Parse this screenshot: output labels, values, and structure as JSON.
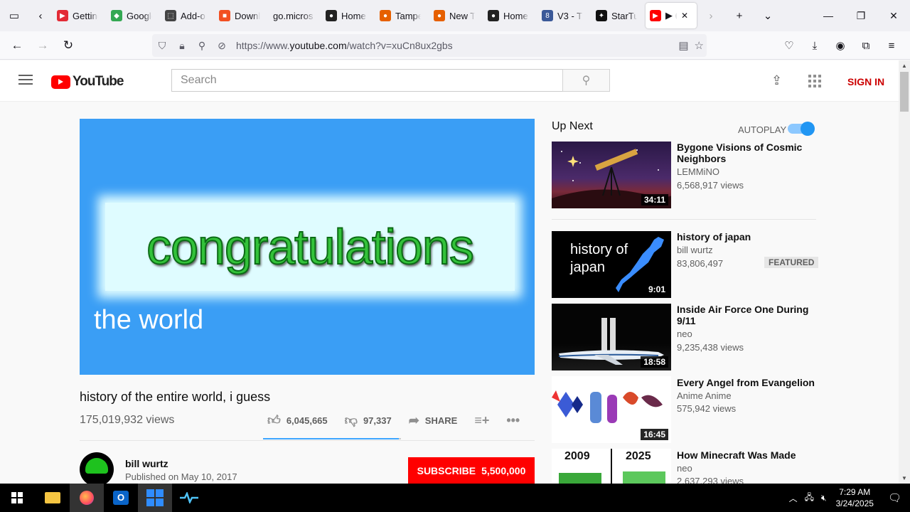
{
  "browser": {
    "tabs": [
      {
        "title": "Getting",
        "color": "#e32b36",
        "glyph": "▶"
      },
      {
        "title": "Google",
        "color": "#34a853",
        "glyph": "◆"
      },
      {
        "title": "Add-o",
        "color": "#444",
        "glyph": "⬚"
      },
      {
        "title": "Downl",
        "color": "#f25022",
        "glyph": "■"
      },
      {
        "title": "go.micros",
        "color": "",
        "glyph": ""
      },
      {
        "title": "Home",
        "color": "#222",
        "glyph": "●"
      },
      {
        "title": "Tampe",
        "color": "#e66000",
        "glyph": "●"
      },
      {
        "title": "New T",
        "color": "#e66000",
        "glyph": "●"
      },
      {
        "title": "Home",
        "color": "#222",
        "glyph": "●"
      },
      {
        "title": "V3 - T",
        "color": "#3b5998",
        "glyph": "8"
      },
      {
        "title": "StarTu",
        "color": "#111",
        "glyph": "✦"
      },
      {
        "title": "▶ (",
        "color": "#ff0000",
        "glyph": "▶"
      }
    ],
    "url_prefix": "https://www.",
    "url_domain": "youtube.com",
    "url_path": "/watch?v=xuCn8ux2gbs"
  },
  "youtube": {
    "logo_text": "YouTube",
    "search_placeholder": "Search",
    "sign_in": "SIGN IN"
  },
  "video": {
    "banner_text": "congratulations",
    "sub_text": "the world",
    "title": "history of the entire world, i guess",
    "views": "175,019,932 views",
    "likes": "6,045,665",
    "like_ratio": 0.984,
    "dislikes": "97,337",
    "share": "SHARE",
    "channel": "bill wurtz",
    "published": "Published on May 10, 2017",
    "subscribe": "SUBSCRIBE",
    "subscribers": "5,500,000"
  },
  "sidebar": {
    "up_next": "Up Next",
    "autoplay": "AUTOPLAY",
    "autoplay_on": true,
    "items": [
      {
        "title": "Bygone Visions of Cosmic Neighbors",
        "channel": "LEMMiNO",
        "views": "6,568,917 views",
        "duration": "34:11"
      },
      {
        "title": "history of japan",
        "channel": "bill wurtz",
        "views": "83,806,497",
        "duration": "9:01",
        "badge": "FEATURED",
        "thumb_text": "history of japan"
      },
      {
        "title": "Inside Air Force One During 9/11",
        "channel": "neo",
        "views": "9,235,438 views",
        "duration": "18:58"
      },
      {
        "title": "Every Angel from Evangelion",
        "channel": "Anime Anime",
        "views": "575,942 views",
        "duration": "16:45"
      },
      {
        "title": "How Minecraft Was Made",
        "channel": "neo",
        "views": "2,637,293 views",
        "thumb_left": "2009",
        "thumb_right": "2025"
      }
    ]
  },
  "taskbar": {
    "time": "7:29 AM",
    "date": "3/24/2025"
  }
}
